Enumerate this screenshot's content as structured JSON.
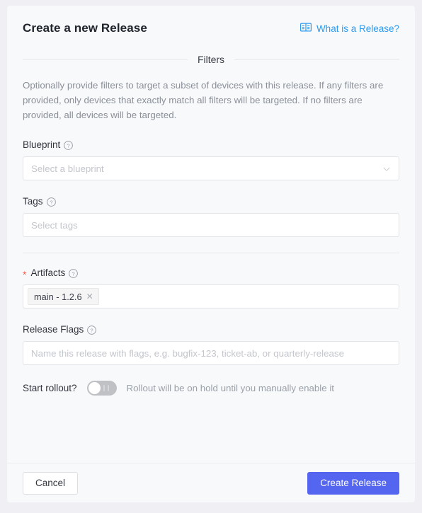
{
  "header": {
    "title": "Create a new Release",
    "help_link_label": "What is a Release?",
    "help_link_icon": "book-icon"
  },
  "filters_section": {
    "divider_label": "Filters",
    "description": "Optionally provide filters to target a subset of devices with this release. If any filters are provided, only devices that exactly match all filters will be targeted. If no filters are provided, all devices will be targeted.",
    "blueprint": {
      "label": "Blueprint",
      "help_icon": "question-circle-icon",
      "placeholder": "Select a blueprint",
      "value": "",
      "chevron_icon": "chevron-down-icon"
    },
    "tags": {
      "label": "Tags",
      "help_icon": "question-circle-icon",
      "placeholder": "Select tags",
      "value": ""
    }
  },
  "artifacts_section": {
    "required_marker": "*",
    "label": "Artifacts",
    "help_icon": "question-circle-icon",
    "chips": [
      {
        "label": "main - 1.2.6",
        "close_icon": "close-icon",
        "close_glyph": "✕"
      }
    ]
  },
  "release_flags": {
    "label": "Release Flags",
    "help_icon": "question-circle-icon",
    "placeholder": "Name this release with flags, e.g. bugfix-123, ticket-ab, or quarterly-release",
    "value": ""
  },
  "rollout": {
    "label": "Start rollout?",
    "toggle_state": "off",
    "hint": "Rollout will be on hold until you manually enable it"
  },
  "footer": {
    "cancel_label": "Cancel",
    "submit_label": "Create Release"
  },
  "colors": {
    "page_background": "#f0f0f4",
    "card_background": "#f8f9fb",
    "primary_button": "#5465f0",
    "link": "#2b9aee",
    "required_star": "#f5594e",
    "toggle_off_track": "#bfc1c4",
    "border": "#e3e4e8"
  }
}
